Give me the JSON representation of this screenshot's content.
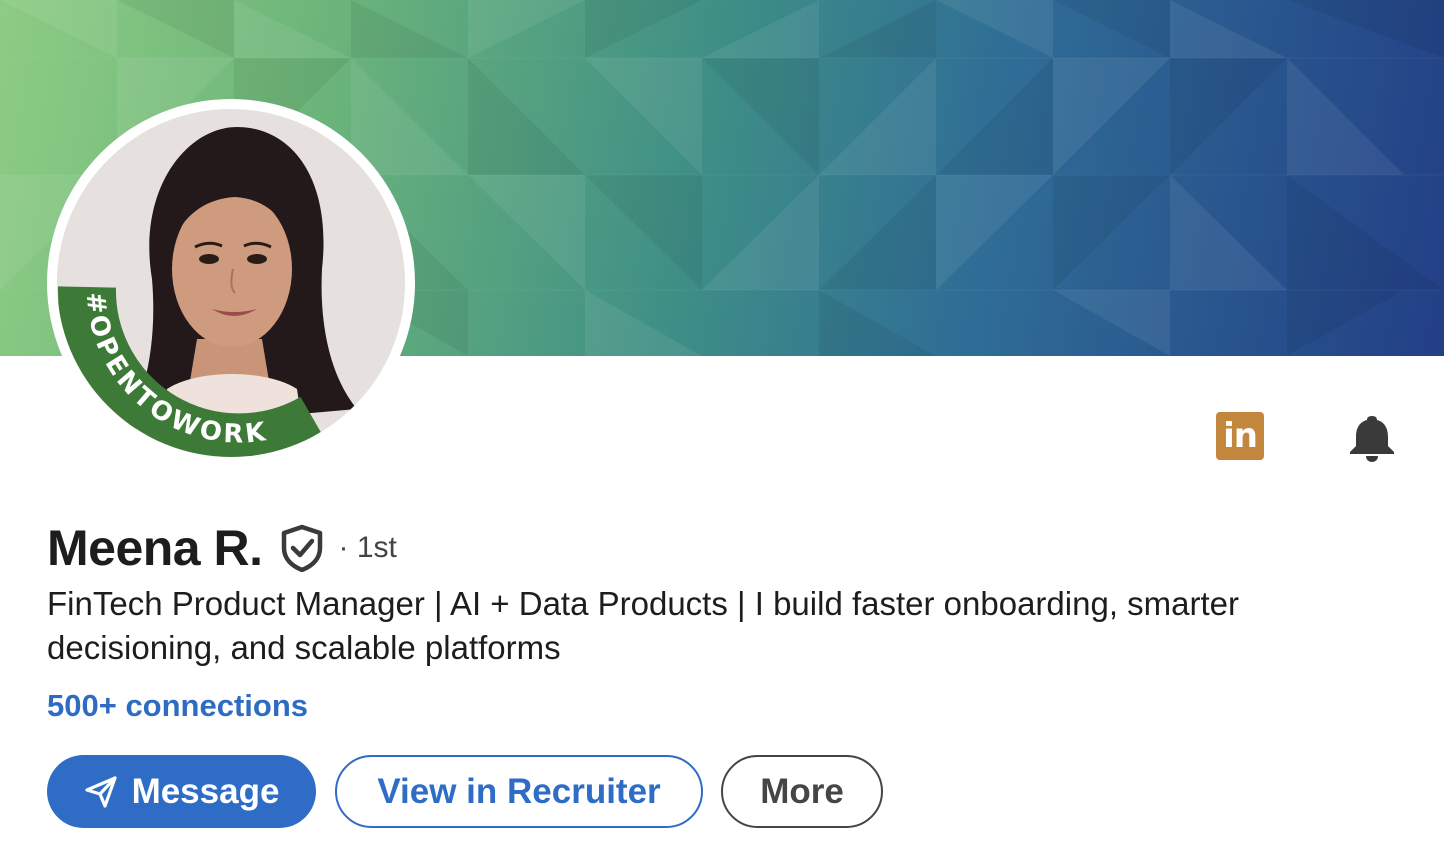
{
  "profile": {
    "name": "Meena R.",
    "degree": "· 1st",
    "headline": "FinTech Product Manager | AI + Data Products | I build faster onboarding, smarter decisioning, and scalable platforms",
    "connections": "500+ connections",
    "avatar_badge": "#OPENTOWORK",
    "verified_icon": "verified-shield-icon"
  },
  "actions": {
    "message": "Message",
    "recruiter": "View in Recruiter",
    "more": "More"
  },
  "icons": {
    "linkedin": "linkedin-icon",
    "bell": "bell-icon",
    "send": "send-icon"
  },
  "colors": {
    "accent": "#2e6cc5",
    "link": "#2d6cc2",
    "open_to_work": "#3e7a37",
    "linkedin_badge": "#c2873d"
  }
}
